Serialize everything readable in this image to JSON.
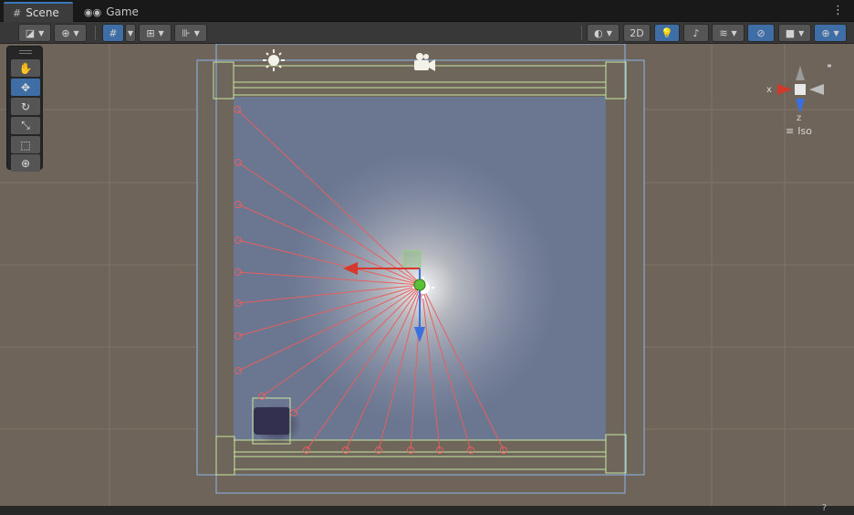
{
  "tabs": [
    {
      "label": "Scene",
      "icon": "grid-icon",
      "active": true
    },
    {
      "label": "Game",
      "icon": "gamepad-icon",
      "active": false
    }
  ],
  "toolbar": {
    "toggle_2d_label": "2D"
  },
  "tools": [
    {
      "name": "hand-tool",
      "glyph": "✋"
    },
    {
      "name": "move-tool",
      "glyph": "✥"
    },
    {
      "name": "rotate-tool",
      "glyph": "↻"
    },
    {
      "name": "scale-tool",
      "glyph": "⤡"
    },
    {
      "name": "rect-tool",
      "glyph": "⬚"
    },
    {
      "name": "transform-tool",
      "glyph": "⊕"
    }
  ],
  "active_tool": "move-tool",
  "gizmo": {
    "axis_x": "x",
    "axis_z": "z",
    "projection_label": "Iso",
    "axis_x_color": "#d0392b",
    "axis_z_color": "#3b6fe0",
    "axis_y_color": "#9a9a9a"
  },
  "colors": {
    "accent": "#3f6ea6",
    "viewport_bg": "#6e6459",
    "ray_color": "#e56060",
    "selection_box": "#c8e6a0",
    "bounds_blue": "#8fb4e8"
  }
}
